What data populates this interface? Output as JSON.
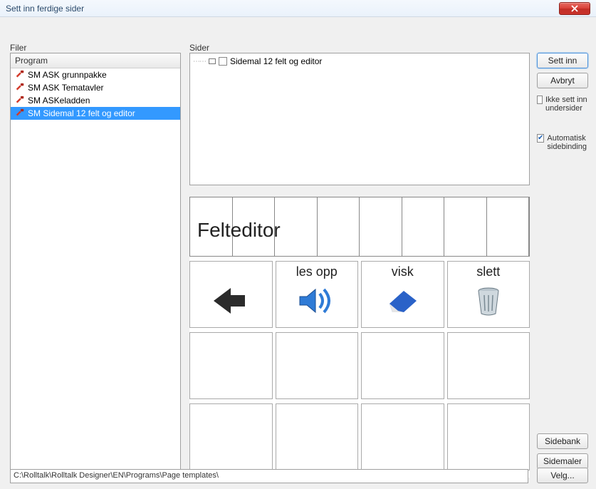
{
  "window": {
    "title": "Sett inn ferdige sider"
  },
  "labels": {
    "filer": "Filer",
    "sider": "Sider",
    "program_header": "Program"
  },
  "tree": {
    "items": [
      {
        "label": "SM ASK grunnpakke",
        "selected": false
      },
      {
        "label": "SM ASK Tematavler",
        "selected": false
      },
      {
        "label": "SM ASKeladden",
        "selected": false
      },
      {
        "label": "SM Sidemal 12 felt og editor",
        "selected": true
      }
    ]
  },
  "pages": {
    "item": "Sidemal 12 felt og editor"
  },
  "buttons": {
    "sett_inn": "Sett inn",
    "avbryt": "Avbryt",
    "sidebank": "Sidebank",
    "sidemaler": "Sidemaler",
    "velg": "Velg..."
  },
  "options": {
    "ikke_sett_inn": "Ikke sett inn undersider",
    "automatisk": "Automatisk sidebinding"
  },
  "preview": {
    "header_text": "Felteditor",
    "cells": {
      "les_opp": "les opp",
      "visk": "visk",
      "slett": "slett"
    }
  },
  "path": "C:\\Rolltalk\\Rolltalk Designer\\EN\\Programs\\Page templates\\"
}
